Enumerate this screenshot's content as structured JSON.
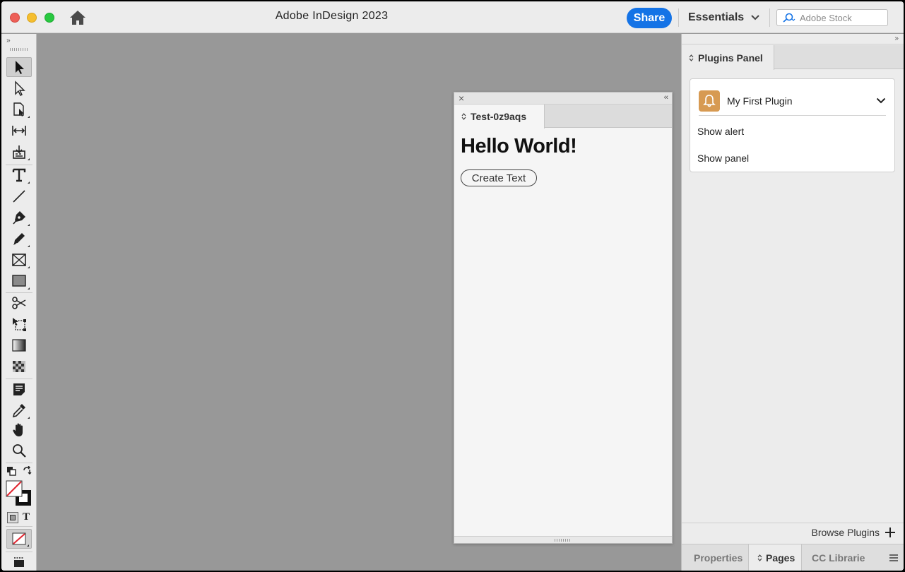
{
  "window": {
    "title": "Adobe InDesign 2023",
    "share_label": "Share",
    "workspace_label": "Essentials",
    "search_placeholder": "Adobe Stock"
  },
  "toolbar": {
    "tools": [
      "selection-tool",
      "direct-selection-tool",
      "page-tool",
      "gap-tool",
      "content-collector-tool",
      "type-tool",
      "line-tool",
      "pen-tool",
      "pencil-tool",
      "rectangle-frame-tool",
      "rectangle-tool",
      "scissors-tool",
      "free-transform-tool",
      "gradient-swatch-tool",
      "gradient-feather-tool",
      "note-tool",
      "eyedropper-tool",
      "hand-tool",
      "zoom-tool"
    ],
    "formatting_text_glyph": "T"
  },
  "floating_panel": {
    "tab_label": "Test-0z9aqs",
    "heading": "Hello World!",
    "button_label": "Create Text"
  },
  "dock": {
    "tab_label": "Plugins Panel",
    "plugin_name": "My First Plugin",
    "items": [
      "Show alert",
      "Show panel"
    ],
    "browse_label": "Browse Plugins",
    "bottom_tabs": [
      "Properties",
      "Pages",
      "CC Librarie"
    ]
  },
  "colors": {
    "accent": "#1473e6",
    "canvas": "#989898",
    "plugin_icon": "#d79a52"
  }
}
